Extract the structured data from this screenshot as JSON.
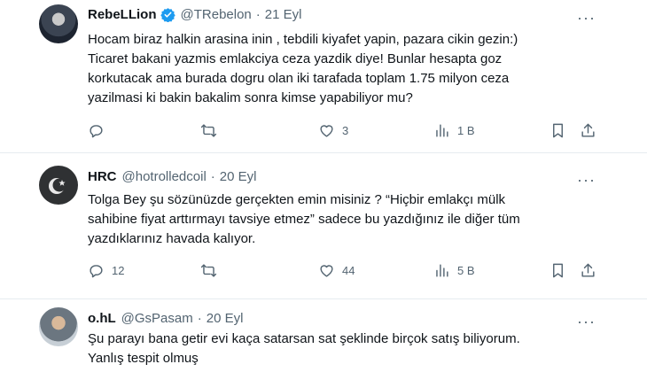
{
  "tweets": [
    {
      "name": "RebeLLion",
      "handle": "@TRebelon",
      "separator": "·",
      "time": "21 Eyl",
      "text": "Hocam biraz halkin arasina inin , tebdili kiyafet yapin, pazara cikin gezin:)\nTicaret bakani yazmis emlakciya ceza yazdik diye! Bunlar hesapta goz\nkorkutacak ama burada dogru olan iki tarafada toplam 1.75 milyon ceza\nyazilmasi ki bakin bakalim sonra kimse yapabiliyor mu?",
      "replies": "",
      "retweets": "",
      "likes": "3",
      "views": "1 B",
      "verified": true
    },
    {
      "name": "HRC",
      "handle": "@hotrolledcoil",
      "separator": "·",
      "time": "20 Eyl",
      "text": "Tolga Bey şu sözünüzde gerçekten emin misiniz ? “Hiçbir emlakçı mülk\nsahibine fiyat arttırmayı tavsiye etmez” sadece bu yazdığınız ile diğer tüm\nyazdıklarınız havada kalıyor.",
      "replies": "12",
      "retweets": "",
      "likes": "44",
      "views": "5 B",
      "verified": false
    },
    {
      "name": "o.hL",
      "handle": "@GsPasam",
      "separator": "·",
      "time": "20 Eyl",
      "text": "Şu parayı bana getir evi kaça satarsan sat şeklinde birçok satış biliyorum.\nYanlış tespit olmuş",
      "verified": false
    }
  ],
  "icons": {
    "reply": "reply-icon",
    "retweet": "retweet-icon",
    "like": "heart-icon",
    "views": "views-icon",
    "bookmark": "bookmark-icon",
    "share": "share-icon",
    "more": "more-icon"
  },
  "colors": {
    "text": "#0f1419",
    "secondary": "#536471",
    "verified": "#1d9bf0",
    "border": "#e6ecf0"
  }
}
